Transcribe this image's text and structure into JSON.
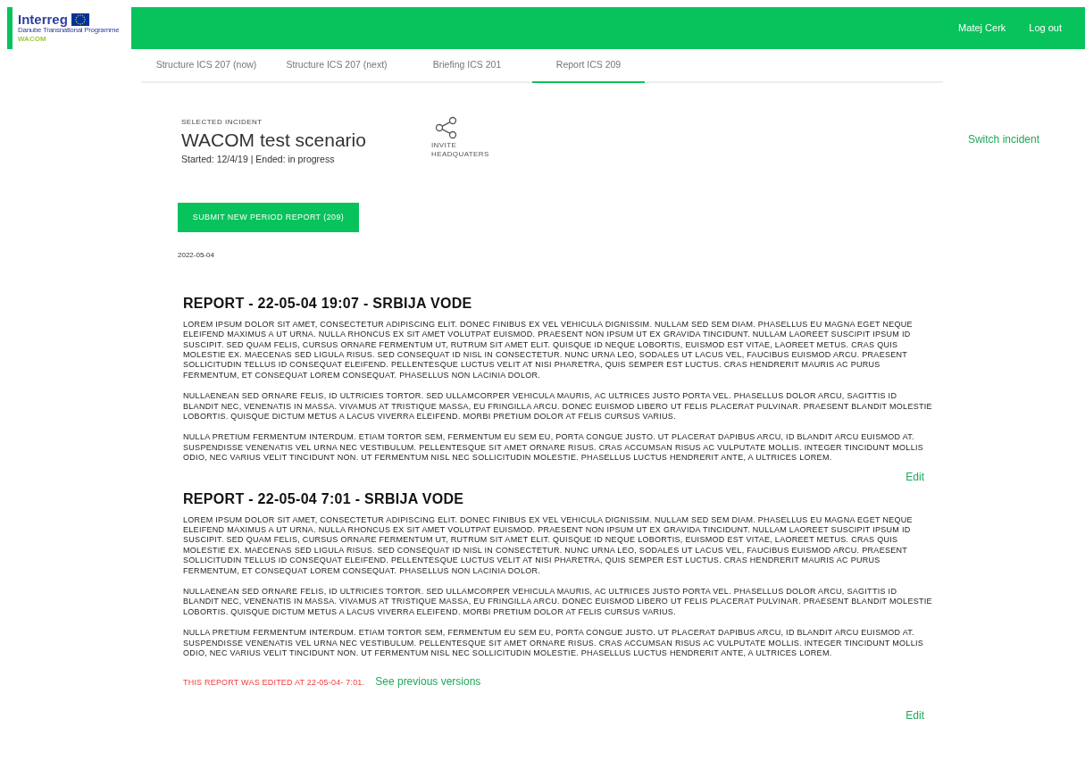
{
  "header": {
    "logo": {
      "brand": "Interreg",
      "subtitle": "Danube Transnational Programme",
      "project": "WACOM"
    },
    "user": "Matej Cerk",
    "logout": "Log out"
  },
  "tabs": [
    {
      "label": "Structure ICS 207 (now)",
      "selected": false
    },
    {
      "label": "Structure ICS 207 (next)",
      "selected": false
    },
    {
      "label": "Briefing ICS 201",
      "selected": false
    },
    {
      "label": "Report ICS 209",
      "selected": true
    }
  ],
  "incident": {
    "caption": "SELECTED INCIDENT",
    "title": "WACOM test scenario",
    "status": "Started: 12/4/19 | Ended: in progress",
    "invite": "INVITE HEADQUATERS",
    "switch": "Switch incident"
  },
  "submit_button": "SUBMIT NEW PERIOD REPORT (209)",
  "date": "2022-05-04",
  "reports": [
    {
      "title": "REPORT - 22-05-04 19:07 - SRBIJA VODE",
      "paragraphs": [
        "LOREM IPSUM DOLOR SIT AMET, CONSECTETUR ADIPISCING ELIT. DONEC FINIBUS EX VEL VEHICULA DIGNISSIM. NULLAM SED SEM DIAM. PHASELLUS EU MAGNA EGET NEQUE ELEIFEND MAXIMUS A UT URNA. NULLA RHONCUS EX SIT AMET VOLUTPAT EUISMOD. PRAESENT NON IPSUM UT EX GRAVIDA TINCIDUNT. NULLAM LAOREET SUSCIPIT IPSUM ID SUSCIPIT. SED QUAM FELIS, CURSUS ORNARE FERMENTUM UT, RUTRUM SIT AMET ELIT. QUISQUE ID NEQUE LOBORTIS, EUISMOD EST VITAE, LAOREET METUS. CRAS QUIS MOLESTIE EX. MAECENAS SED LIGULA RISUS. SED CONSEQUAT ID NISL IN CONSECTETUR. NUNC URNA LEO, SODALES UT LACUS VEL, FAUCIBUS EUISMOD ARCU. PRAESENT SOLLICITUDIN TELLUS ID CONSEQUAT ELEIFEND. PELLENTESQUE LUCTUS VELIT AT NISI PHARETRA, QUIS SEMPER EST LUCTUS. CRAS HENDRERIT MAURIS AC PURUS FERMENTUM, ET CONSEQUAT LOREM CONSEQUAT. PHASELLUS NON LACINIA DOLOR.",
        "NULLAENEAN SED ORNARE FELIS, ID ULTRICIES TORTOR. SED ULLAMCORPER VEHICULA MAURIS, AC ULTRICES JUSTO PORTA VEL. PHASELLUS DOLOR ARCU, SAGITTIS ID BLANDIT NEC, VENENATIS IN MASSA. VIVAMUS AT TRISTIQUE MASSA, EU FRINGILLA ARCU. DONEC EUISMOD LIBERO UT FELIS PLACERAT PULVINAR. PRAESENT BLANDIT MOLESTIE LOBORTIS. QUISQUE DICTUM METUS A LACUS VIVERRA ELEIFEND. MORBI PRETIUM DOLOR AT FELIS CURSUS VARIUS.",
        "NULLA PRETIUM FERMENTUM INTERDUM. ETIAM TORTOR SEM, FERMENTUM EU SEM EU, PORTA CONGUE JUSTO. UT PLACERAT DAPIBUS ARCU, ID BLANDIT ARCU EUISMOD AT. SUSPENDISSE VENENATIS VEL URNA NEC VESTIBULUM. PELLENTESQUE SIT AMET ORNARE RISUS. CRAS ACCUMSAN RISUS AC VULPUTATE MOLLIS. INTEGER TINCIDUNT MOLLIS ODIO, NEC VARIUS VELIT TINCIDUNT NON. UT FERMENTUM NISL NEC SOLLICITUDIN MOLESTIE. PHASELLUS LUCTUS HENDRERIT ANTE, A ULTRICES LOREM."
      ],
      "edit": "Edit"
    },
    {
      "title": "REPORT - 22-05-04 7:01 - SRBIJA VODE",
      "paragraphs": [
        "LOREM IPSUM DOLOR SIT AMET, CONSECTETUR ADIPISCING ELIT. DONEC FINIBUS EX VEL VEHICULA DIGNISSIM. NULLAM SED SEM DIAM. PHASELLUS EU MAGNA EGET NEQUE ELEIFEND MAXIMUS A UT URNA. NULLA RHONCUS EX SIT AMET VOLUTPAT EUISMOD. PRAESENT NON IPSUM UT EX GRAVIDA TINCIDUNT. NULLAM LAOREET SUSCIPIT IPSUM ID SUSCIPIT. SED QUAM FELIS, CURSUS ORNARE FERMENTUM UT, RUTRUM SIT AMET ELIT. QUISQUE ID NEQUE LOBORTIS, EUISMOD EST VITAE, LAOREET METUS. CRAS QUIS MOLESTIE EX. MAECENAS SED LIGULA RISUS. SED CONSEQUAT ID NISL IN CONSECTETUR. NUNC URNA LEO, SODALES UT LACUS VEL, FAUCIBUS EUISMOD ARCU. PRAESENT SOLLICITUDIN TELLUS ID CONSEQUAT ELEIFEND. PELLENTESQUE LUCTUS VELIT AT NISI PHARETRA, QUIS SEMPER EST LUCTUS. CRAS HENDRERIT MAURIS AC PURUS FERMENTUM, ET CONSEQUAT LOREM CONSEQUAT. PHASELLUS NON LACINIA DOLOR.",
        "NULLAENEAN SED ORNARE FELIS, ID ULTRICIES TORTOR. SED ULLAMCORPER VEHICULA MAURIS, AC ULTRICES JUSTO PORTA VEL. PHASELLUS DOLOR ARCU, SAGITTIS ID BLANDIT NEC, VENENATIS IN MASSA. VIVAMUS AT TRISTIQUE MASSA, EU FRINGILLA ARCU. DONEC EUISMOD LIBERO UT FELIS PLACERAT PULVINAR. PRAESENT BLANDIT MOLESTIE LOBORTIS. QUISQUE DICTUM METUS A LACUS VIVERRA ELEIFEND. MORBI PRETIUM DOLOR AT FELIS CURSUS VARIUS.",
        "NULLA PRETIUM FERMENTUM INTERDUM. ETIAM TORTOR SEM, FERMENTUM EU SEM EU, PORTA CONGUE JUSTO. UT PLACERAT DAPIBUS ARCU, ID BLANDIT ARCU EUISMOD AT. SUSPENDISSE VENENATIS VEL URNA NEC VESTIBULUM. PELLENTESQUE SIT AMET ORNARE RISUS. CRAS ACCUMSAN RISUS AC VULPUTATE MOLLIS. INTEGER TINCIDUNT MOLLIS ODIO, NEC VARIUS VELIT TINCIDUNT NON. UT FERMENTUM NISL NEC SOLLICITUDIN MOLESTIE. PHASELLUS LUCTUS HENDRERIT ANTE, A ULTRICES LOREM."
      ],
      "edited_notice": "THIS REPORT WAS EDITED AT 22-05-04- 7:01.",
      "previous_versions": "See previous versions",
      "edit": "Edit"
    }
  ]
}
